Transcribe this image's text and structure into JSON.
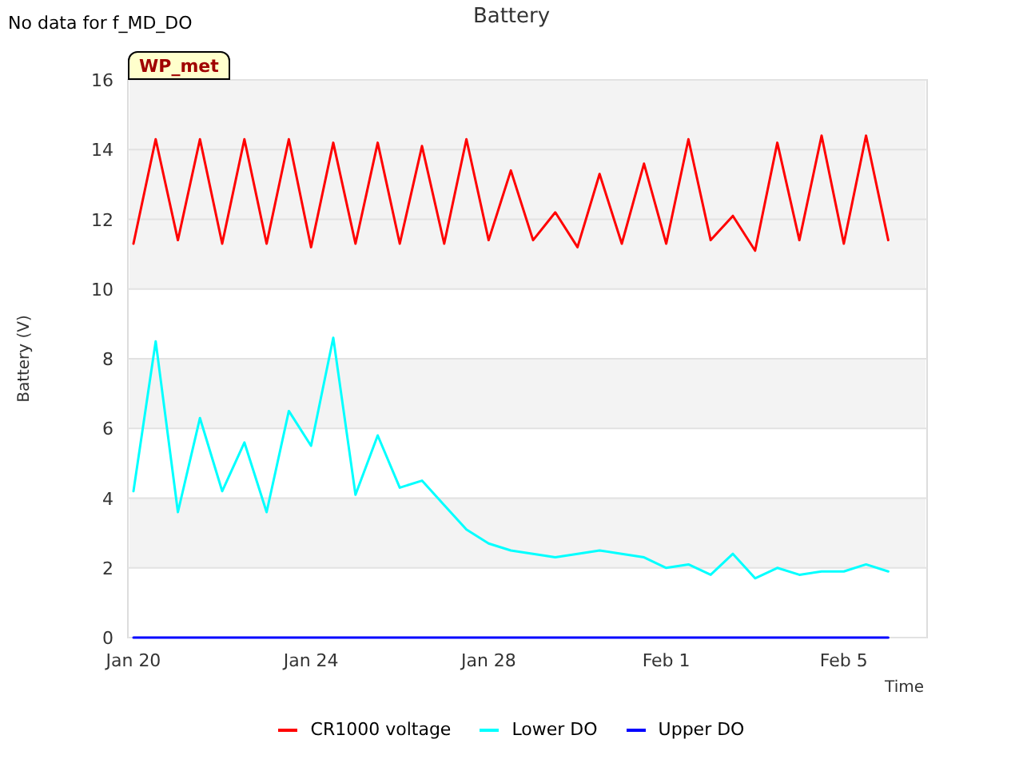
{
  "note": "No data for f_MD_DO",
  "badge": "WP_met",
  "chart_data": {
    "type": "line",
    "title": "Battery",
    "xlabel": "Time",
    "ylabel": "Battery (V)",
    "categories": [
      "Jan 20",
      null,
      null,
      null,
      null,
      null,
      null,
      null,
      "Jan 24",
      null,
      null,
      null,
      null,
      null,
      null,
      null,
      "Jan 28",
      null,
      null,
      null,
      null,
      null,
      null,
      null,
      "Feb 1",
      null,
      null,
      null,
      null,
      null,
      null,
      null,
      "Feb 5",
      null,
      null
    ],
    "series": [
      {
        "name": "CR1000 voltage",
        "color": "#ff0000",
        "values": [
          11.3,
          14.3,
          11.4,
          14.3,
          11.3,
          14.3,
          11.3,
          14.3,
          11.2,
          14.2,
          11.3,
          14.2,
          11.3,
          14.1,
          11.3,
          14.3,
          11.4,
          13.4,
          11.4,
          12.2,
          11.2,
          13.3,
          11.3,
          13.6,
          11.3,
          14.3,
          11.4,
          12.1,
          11.1,
          14.2,
          11.4,
          14.4,
          11.3,
          14.4,
          11.4
        ]
      },
      {
        "name": "Lower DO",
        "color": "#00ffff",
        "values": [
          4.2,
          8.5,
          3.6,
          6.3,
          4.2,
          5.6,
          3.6,
          6.5,
          5.5,
          8.6,
          4.1,
          5.8,
          4.3,
          4.5,
          3.8,
          3.1,
          2.7,
          2.5,
          2.4,
          2.3,
          2.4,
          2.5,
          2.4,
          2.3,
          2.0,
          2.1,
          1.8,
          2.4,
          1.7,
          2.0,
          1.8,
          1.9,
          1.9,
          2.1,
          1.9
        ]
      },
      {
        "name": "Upper DO",
        "color": "#0000ff",
        "values": [
          0,
          0,
          0,
          0,
          0,
          0,
          0,
          0,
          0,
          0,
          0,
          0,
          0,
          0,
          0,
          0,
          0,
          0,
          0,
          0,
          0,
          0,
          0,
          0,
          0,
          0,
          0,
          0,
          0,
          0,
          0,
          0,
          0,
          0,
          0
        ]
      }
    ],
    "ylim": [
      0,
      16
    ],
    "grid": true,
    "yticks": [
      0,
      2,
      4,
      6,
      8,
      10,
      12,
      14,
      16
    ]
  }
}
